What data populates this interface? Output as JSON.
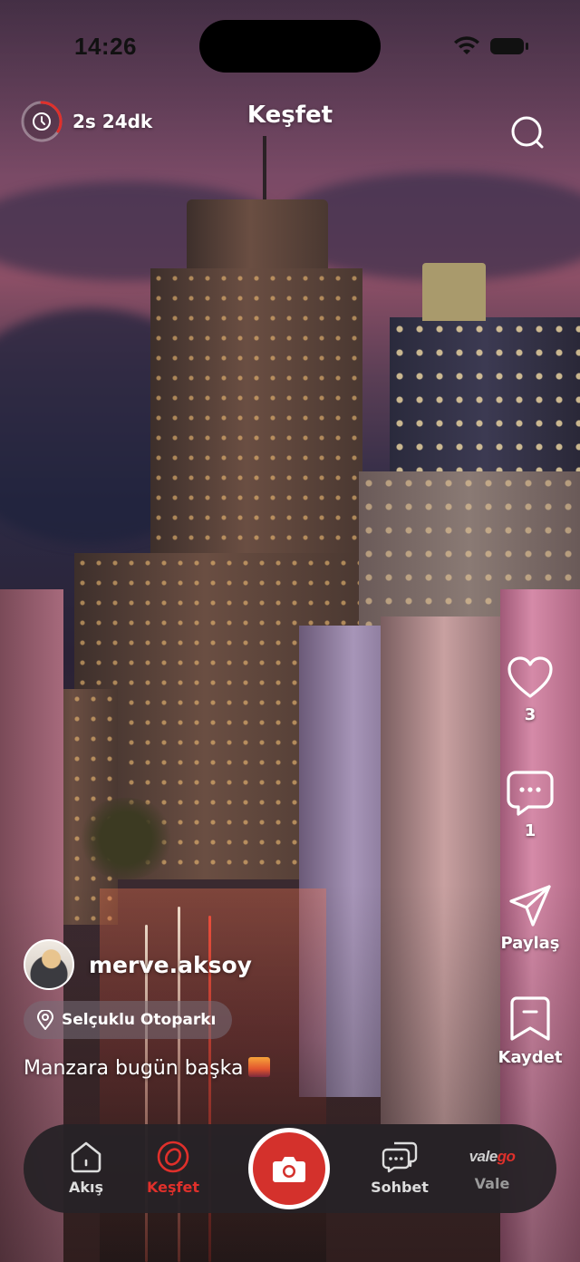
{
  "status_bar": {
    "time": "14:26"
  },
  "header": {
    "timer": "2s 24dk",
    "title": "Keşfet"
  },
  "actions": {
    "like_count": "3",
    "comment_count": "1",
    "share_label": "Paylaş",
    "save_label": "Kaydet"
  },
  "post": {
    "username": "merve.aksoy",
    "location": "Selçuklu Otoparkı",
    "caption": "Manzara bugün başka"
  },
  "nav": {
    "items": [
      {
        "label": "Akış",
        "icon": "home-icon",
        "active": false
      },
      {
        "label": "Keşfet",
        "icon": "explore-icon",
        "active": true
      },
      {
        "label": "Sohbet",
        "icon": "chat-icon",
        "active": false
      },
      {
        "label": "Vale",
        "icon": "valego-logo",
        "active": false
      }
    ],
    "valego_logo_text": {
      "part1": "vale",
      "part2": "go"
    }
  },
  "colors": {
    "accent": "#e0302b",
    "camera_button": "#d4312c",
    "nav_bg": "#262226"
  }
}
